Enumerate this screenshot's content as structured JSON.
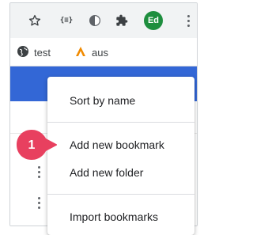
{
  "toolbar": {
    "extension_json_label": "{≡}",
    "profile_initials": "Ed",
    "icons": [
      "star-icon",
      "json-viewer-icon",
      "half-circle-icon",
      "puzzle-icon",
      "more-vert-icon"
    ]
  },
  "bookmarks_bar": {
    "items": [
      {
        "label": "test",
        "icon": "globe-icon"
      },
      {
        "label": "aus",
        "icon": "orange-chevron-icon"
      }
    ]
  },
  "menu": {
    "items": [
      {
        "label": "Sort by name"
      },
      {
        "label": "Add new bookmark"
      },
      {
        "label": "Add new folder"
      },
      {
        "label": "Import bookmarks"
      }
    ]
  },
  "callout": {
    "number": "1",
    "color": "#e8405f"
  },
  "colors": {
    "header_band": "#3367d6",
    "avatar": "#1e8e3e",
    "toolbar": "#f1f3f4"
  }
}
